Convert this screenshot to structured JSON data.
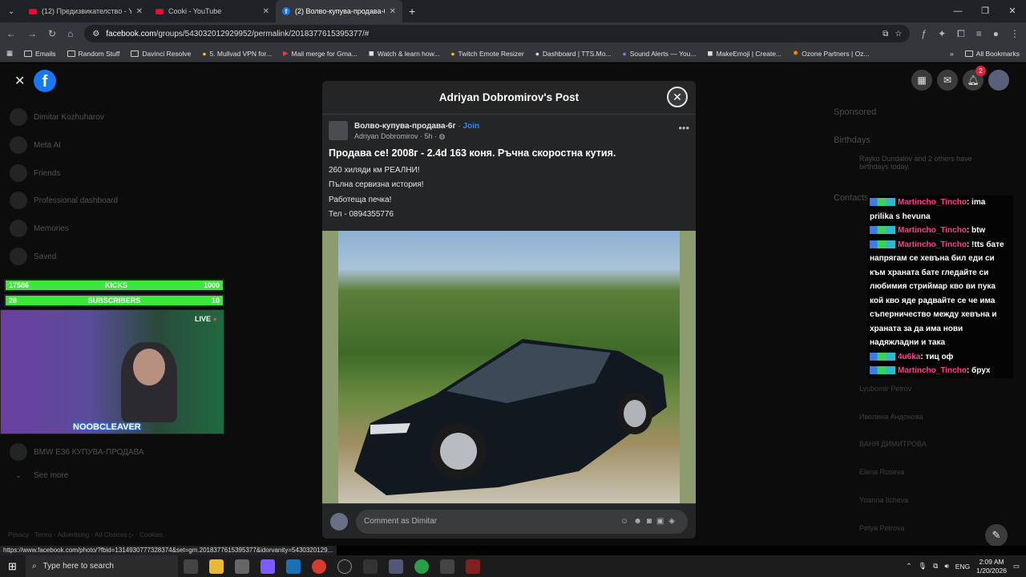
{
  "tabs": [
    {
      "title": "(12) Предизвикателство - YouT",
      "icon": "youtube-icon"
    },
    {
      "title": "Cooki - YouTube",
      "icon": "youtube-icon"
    },
    {
      "title": "(2) Волво-купува-продава-6г",
      "icon": "facebook-icon"
    }
  ],
  "url": {
    "host": "facebook.com",
    "path": "/groups/543032012929952/permalink/2018377615395377/#"
  },
  "bookmarks": [
    "Emails",
    "Random Stuff",
    "Davinci Resolve",
    "5. Mullvad VPN for...",
    "Mail merge for Gma...",
    "Watch & learn how...",
    "Twitch Emote Resizer",
    "Dashboard | TTS.Mo...",
    "Sound Alerts — You...",
    "MakeEmoji | Create...",
    "Ozone Partners | Oz..."
  ],
  "all_bookmarks": "All Bookmarks",
  "sidebar": {
    "user": "Dimitar Kozhuharov",
    "items": [
      "Meta AI",
      "Friends",
      "Professional dashboard",
      "Memories",
      "Saved"
    ],
    "group": "BMW E36 КУПУВА-ПРОДАВА",
    "see_more": "See more",
    "footer": "Privacy · Terms · Advertising · Ad Choices ▷ · Cookies"
  },
  "right": {
    "sponsored": "Sponsored",
    "birthdays": "Birthdays",
    "birthday_text": "Rayko Dundalov and 2 others have birthdays today.",
    "contacts": "Contacts",
    "contacts_list": [
      "Lyubomir Petrov",
      "Ивелина Андонова",
      "ВАНЯ ДИМИТРОВА",
      "Elena Ruseva",
      "Yoanna Ilcheva",
      "Petya Petrova"
    ]
  },
  "notif_count": "2",
  "modal": {
    "title": "Adriyan Dobromirov's Post",
    "group": "Волво-купува-продава-6г",
    "join": "Join",
    "author": "Adriyan Dobromirov",
    "time": "5h",
    "headline": "Продава се! 2008г - 2.4d 163 коня. Ръчна скоростна кутия.",
    "lines": [
      "260 хиляди км РЕАЛНИ!",
      "Пълна сервизна история!",
      "Работеща печка!",
      "Тел - 0894355776"
    ],
    "comment_placeholder": "Comment as Dimitar"
  },
  "stream": {
    "kicks_label": "KICKS",
    "kicks_value": "17586",
    "kicks_goal": "1000",
    "subs_label": "SUBSCRIBERS",
    "subs_value": "28",
    "subs_goal": "10",
    "live": "LIVE",
    "streamer": "NOOBCLEAVER"
  },
  "chat": [
    {
      "user": "Martincho_Tincho",
      "text": ": ima prilika s hevuna"
    },
    {
      "user": "Martincho_Tincho",
      "text": ": btw"
    },
    {
      "user": "Martincho_Tincho",
      "text": ": !tts бате напрягам се хевъна бил еди си към храната бате гледайте си любимия стриймар кво ви пука кой кво яде радвайте се че има съперничество между хевъна и храната за да има нови надяжладни и така"
    },
    {
      "user": "4u6ka",
      "text": ": тиц оф"
    },
    {
      "user": "Martincho_Tincho",
      "text": ": брух"
    }
  ],
  "status_url": "https://www.facebook.com/photo/?fbid=1314930777328374&set=gm.2018377615395377&idorvanity=5430320129...",
  "taskbar": {
    "search_placeholder": "Type here to search",
    "lang": "ENG",
    "time": "2:09 AM",
    "date": "1/20/2026"
  }
}
